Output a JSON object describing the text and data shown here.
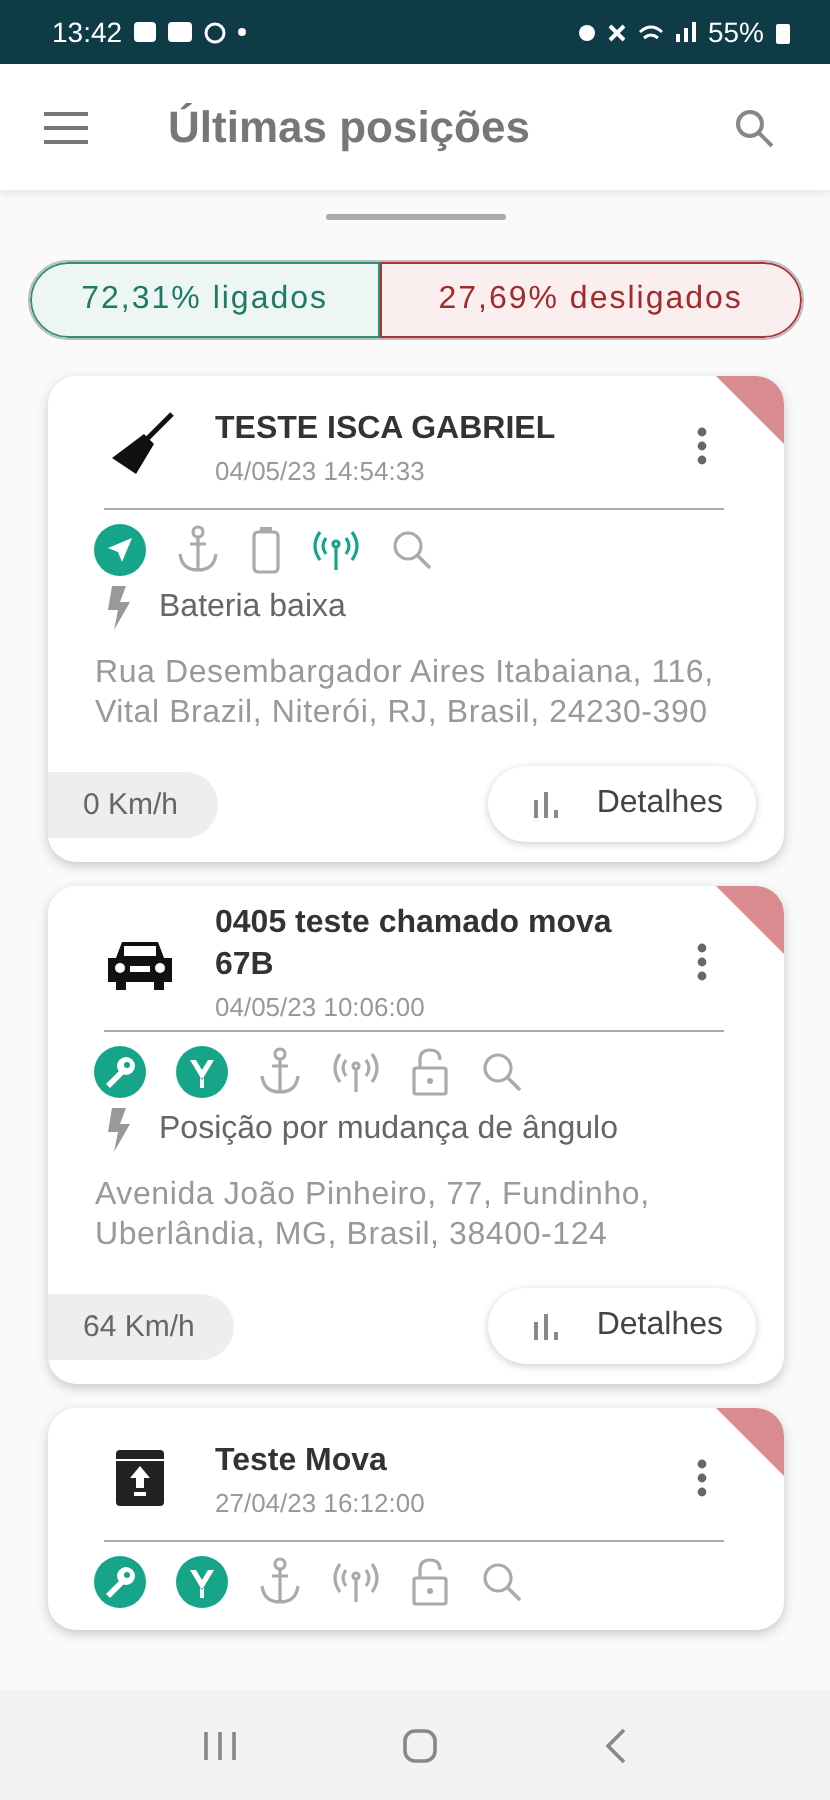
{
  "status_bar": {
    "time": "13:42",
    "battery": "55%"
  },
  "app_bar": {
    "title": "Últimas posições"
  },
  "summary": {
    "on": "72,31% ligados",
    "off": "27,69% desligados"
  },
  "cards": [
    {
      "kind": "broom",
      "name": "TESTE ISCA GABRIEL",
      "date": "04/05/23 14:54:33",
      "offline": true,
      "status": [
        {
          "kind": "navigation",
          "active": true
        },
        {
          "kind": "anchor",
          "active": false
        },
        {
          "kind": "battery",
          "active": false
        },
        {
          "kind": "signal",
          "active": true
        },
        {
          "kind": "search",
          "active": false
        }
      ],
      "event": "Bateria baixa",
      "address": "Rua Desembargador Aires Itabaiana, 116, Vital Brazil, Niterói, RJ, Brasil, 24230-390",
      "speed": "0 Km/h",
      "action": "Detalhes"
    },
    {
      "kind": "car",
      "name": "0405 teste chamado mova 67B",
      "date": "04/05/23 10:06:00",
      "offline": true,
      "status": [
        {
          "kind": "key",
          "active": true
        },
        {
          "kind": "ignition",
          "active": true
        },
        {
          "kind": "anchor",
          "active": false
        },
        {
          "kind": "signal",
          "active": false
        },
        {
          "kind": "lock",
          "active": false
        },
        {
          "kind": "search",
          "active": false
        }
      ],
      "event": "Posição por mudança de ângulo",
      "address": "Avenida João Pinheiro, 77, Fundinho, Uberlândia, MG, Brasil, 38400-124",
      "speed": "64 Km/h",
      "action": "Detalhes"
    },
    {
      "kind": "box",
      "name": "Teste Mova",
      "date": "27/04/23 16:12:00",
      "offline": true,
      "status": [
        {
          "kind": "key",
          "active": true
        },
        {
          "kind": "ignition",
          "active": true
        },
        {
          "kind": "anchor",
          "active": false
        },
        {
          "kind": "signal",
          "active": false
        },
        {
          "kind": "lock",
          "active": false
        },
        {
          "kind": "search",
          "active": false
        }
      ]
    }
  ]
}
